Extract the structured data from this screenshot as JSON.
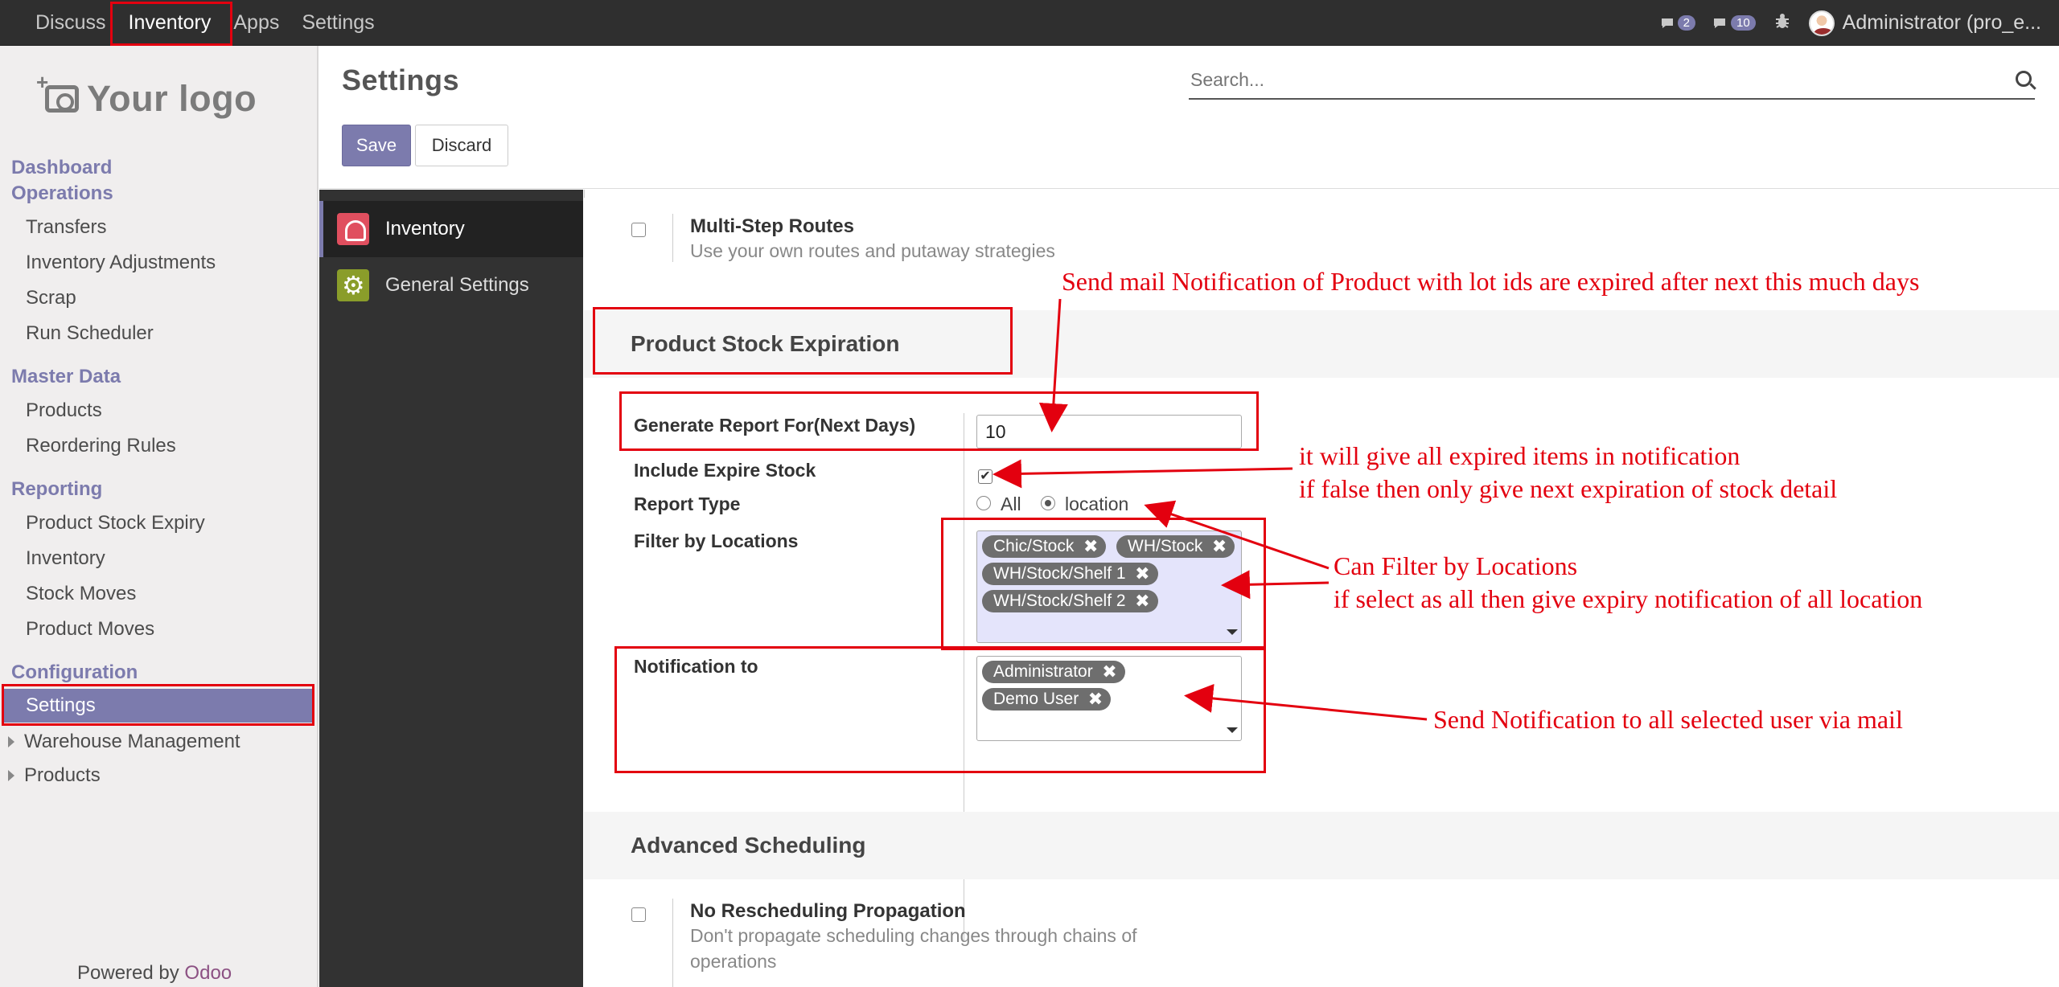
{
  "navbar": {
    "menu": [
      "Discuss",
      "Inventory",
      "Apps",
      "Settings"
    ],
    "badges": [
      {
        "icon": "chat-icon",
        "count": "2"
      },
      {
        "icon": "activity-icon",
        "count": "10"
      }
    ],
    "user": "Administrator (pro_e..."
  },
  "sidebar": {
    "logo": "Your logo",
    "sections": [
      {
        "title": "Dashboard",
        "items": []
      },
      {
        "title": "Operations",
        "items": [
          "Transfers",
          "Inventory Adjustments",
          "Scrap",
          "Run Scheduler"
        ]
      },
      {
        "title": "Master Data",
        "items": [
          "Products",
          "Reordering Rules"
        ]
      },
      {
        "title": "Reporting",
        "items": [
          "Product Stock Expiry",
          "Inventory",
          "Stock Moves",
          "Product Moves"
        ]
      },
      {
        "title": "Configuration",
        "items": [
          "Settings"
        ]
      }
    ],
    "tree_items": [
      "Warehouse Management",
      "Products"
    ],
    "powered_by": "Powered by",
    "powered_brand": "Odoo"
  },
  "control_panel": {
    "title": "Settings",
    "save_label": "Save",
    "discard_label": "Discard",
    "search_placeholder": "Search..."
  },
  "apps": [
    {
      "label": "Inventory",
      "icon": "inventory-app-icon",
      "active": true
    },
    {
      "label": "General Settings",
      "icon": "gear-icon",
      "active": false
    }
  ],
  "settings": {
    "multi_step": {
      "title": "Multi-Step Routes",
      "desc": "Use your own routes and putaway strategies"
    },
    "expiration_section": "Product Stock Expiration",
    "generate_label": "Generate Report For(Next Days)",
    "generate_value": "10",
    "include_label": "Include Expire Stock",
    "include_checked": true,
    "report_type_label": "Report Type",
    "report_type_options": [
      "All",
      "location"
    ],
    "report_type_selected": "location",
    "filter_label": "Filter by Locations",
    "filter_tags": [
      "Chic/Stock",
      "WH/Stock",
      "WH/Stock/Shelf 1",
      "WH/Stock/Shelf 2"
    ],
    "notify_label": "Notification to",
    "notify_tags": [
      "Administrator",
      "Demo User"
    ],
    "advanced_section": "Advanced Scheduling",
    "no_resched": {
      "title": "No Rescheduling Propagation",
      "desc1": "Don't propagate scheduling changes through chains of",
      "desc2": "operations"
    }
  },
  "annotations": {
    "days_note": "Send mail Notification of Product with lot ids are expired after next this much days",
    "expire_note1": "it will give all expired items in notification",
    "expire_note2": "if false then only give next expiration of stock detail",
    "filter_note1": "Can Filter by Locations",
    "filter_note2": "if select as all then give expiry notification of all location",
    "notify_note": "Send Notification to all selected user via mail"
  },
  "colors": {
    "accent": "#7c7bad",
    "annotation": "#e3000f",
    "navbar": "#2f2f2f"
  }
}
